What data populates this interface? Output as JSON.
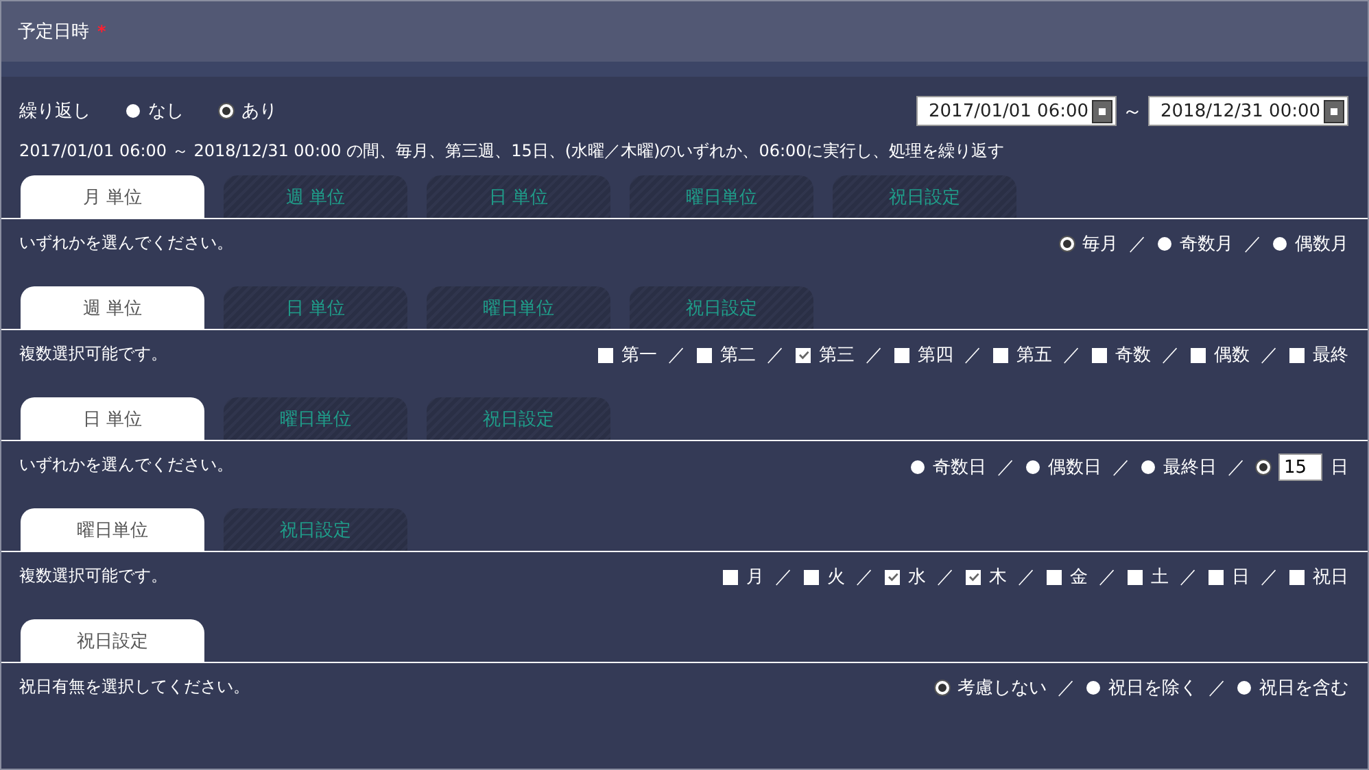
{
  "header": {
    "title": "予定日時",
    "required_mark": "*"
  },
  "repeat": {
    "label": "繰り返し",
    "options": [
      {
        "label": "なし",
        "selected": false
      },
      {
        "label": "あり",
        "selected": true
      }
    ]
  },
  "date_range": {
    "start": "2017/01/01 06:00",
    "separator": "～",
    "end": "2018/12/31 00:00"
  },
  "summary": "2017/01/01 06:00 ～ 2018/12/31 00:00 の間、毎月、第三週、15日、(水曜／木曜)のいずれか、06:00に実行し、処理を繰り返す",
  "sections": [
    {
      "tabs": [
        {
          "label": "月 単位",
          "selected": true
        },
        {
          "label": "週 単位",
          "selected": false
        },
        {
          "label": "日 単位",
          "selected": false
        },
        {
          "label": "曜日単位",
          "selected": false
        },
        {
          "label": "祝日設定",
          "selected": false
        }
      ],
      "hint": "いずれかを選んでください。",
      "separator": "／",
      "options": [
        {
          "kind": "radio",
          "label": "毎月",
          "selected": true
        },
        {
          "kind": "radio",
          "label": "奇数月",
          "selected": false
        },
        {
          "kind": "radio",
          "label": "偶数月",
          "selected": false
        }
      ]
    },
    {
      "tabs": [
        {
          "label": "週 単位",
          "selected": true
        },
        {
          "label": "日 単位",
          "selected": false
        },
        {
          "label": "曜日単位",
          "selected": false
        },
        {
          "label": "祝日設定",
          "selected": false
        }
      ],
      "hint": "複数選択可能です。",
      "separator": "／",
      "options": [
        {
          "kind": "checkbox",
          "label": "第一",
          "checked": false
        },
        {
          "kind": "checkbox",
          "label": "第二",
          "checked": false
        },
        {
          "kind": "checkbox",
          "label": "第三",
          "checked": true
        },
        {
          "kind": "checkbox",
          "label": "第四",
          "checked": false
        },
        {
          "kind": "checkbox",
          "label": "第五",
          "checked": false
        },
        {
          "kind": "checkbox",
          "label": "奇数",
          "checked": false
        },
        {
          "kind": "checkbox",
          "label": "偶数",
          "checked": false
        },
        {
          "kind": "checkbox",
          "label": "最終",
          "checked": false
        }
      ]
    },
    {
      "tabs": [
        {
          "label": "日 単位",
          "selected": true
        },
        {
          "label": "曜日単位",
          "selected": false
        },
        {
          "label": "祝日設定",
          "selected": false
        }
      ],
      "hint": "いずれかを選んでください。",
      "separator": "／",
      "options": [
        {
          "kind": "radio",
          "label": "奇数日",
          "selected": false
        },
        {
          "kind": "radio",
          "label": "偶数日",
          "selected": false
        },
        {
          "kind": "radio",
          "label": "最終日",
          "selected": false
        },
        {
          "kind": "radio-input",
          "value": "15",
          "suffix": "日",
          "selected": true
        }
      ]
    },
    {
      "tabs": [
        {
          "label": "曜日単位",
          "selected": true
        },
        {
          "label": "祝日設定",
          "selected": false
        }
      ],
      "hint": "複数選択可能です。",
      "separator": "／",
      "options": [
        {
          "kind": "checkbox",
          "label": "月",
          "checked": false
        },
        {
          "kind": "checkbox",
          "label": "火",
          "checked": false
        },
        {
          "kind": "checkbox",
          "label": "水",
          "checked": true
        },
        {
          "kind": "checkbox",
          "label": "木",
          "checked": true
        },
        {
          "kind": "checkbox",
          "label": "金",
          "checked": false
        },
        {
          "kind": "checkbox",
          "label": "土",
          "checked": false
        },
        {
          "kind": "checkbox",
          "label": "日",
          "checked": false
        },
        {
          "kind": "checkbox",
          "label": "祝日",
          "checked": false
        }
      ]
    },
    {
      "tabs": [
        {
          "label": "祝日設定",
          "selected": true
        }
      ],
      "hint": "祝日有無を選択してください。",
      "separator": "／",
      "options": [
        {
          "kind": "radio",
          "label": "考慮しない",
          "selected": true
        },
        {
          "kind": "radio",
          "label": "祝日を除く",
          "selected": false
        },
        {
          "kind": "radio",
          "label": "祝日を含む",
          "selected": false
        }
      ]
    }
  ]
}
